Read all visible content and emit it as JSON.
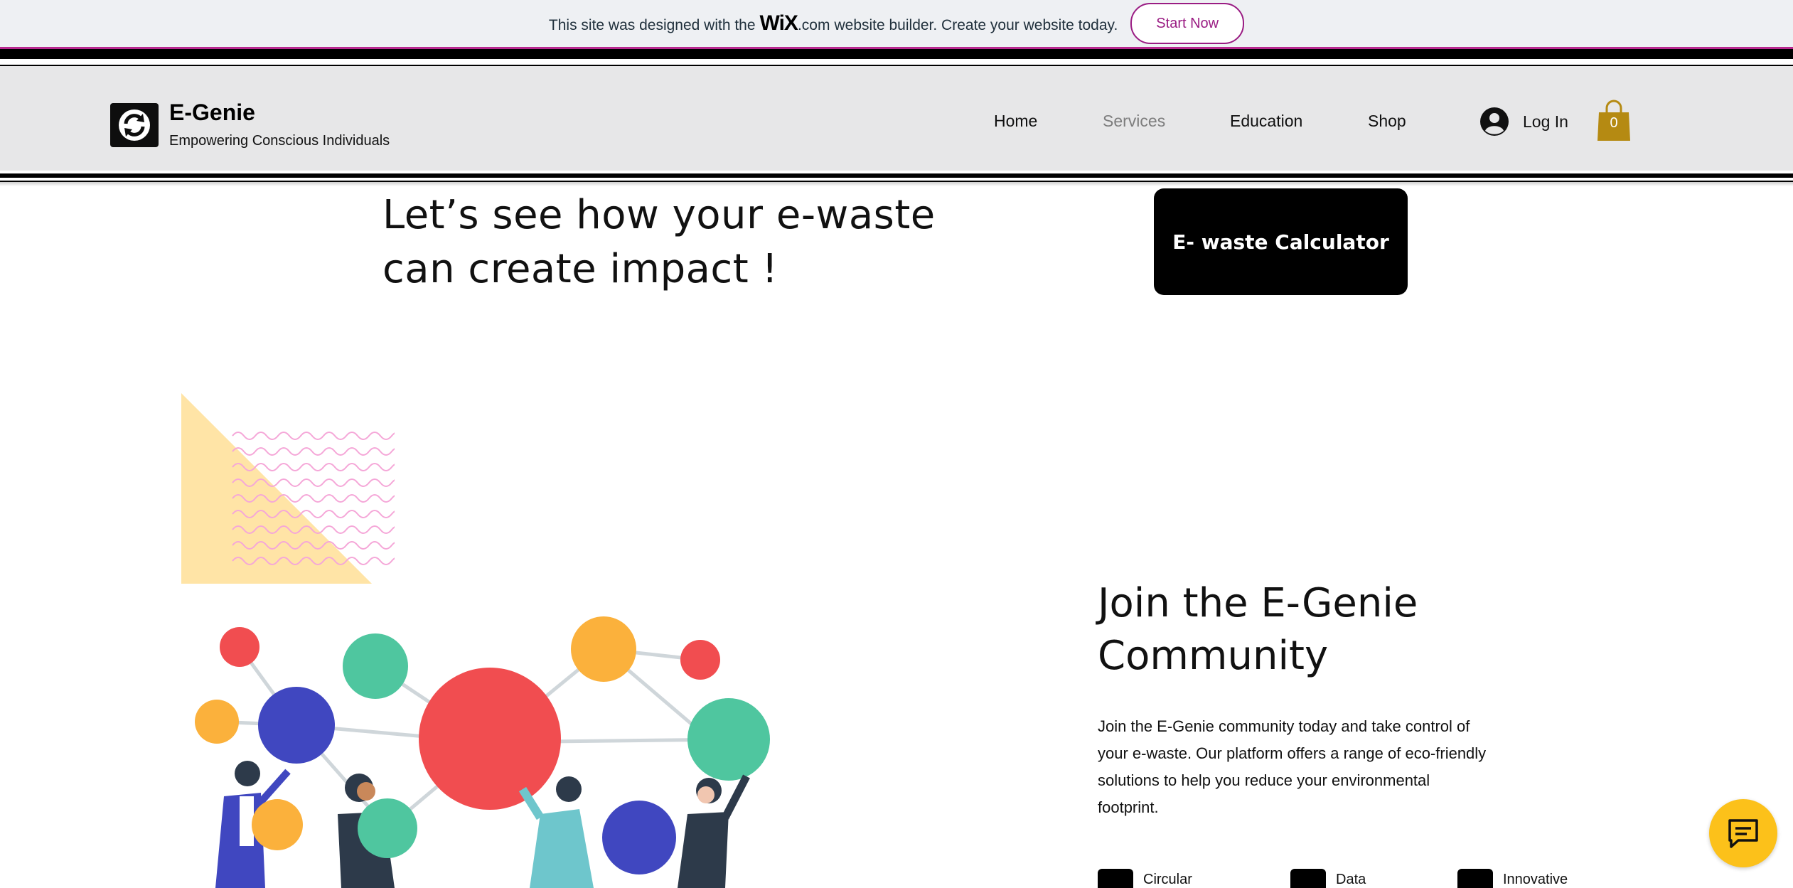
{
  "wix_banner": {
    "text_before": "This site was designed with the",
    "logo": "WiX",
    "logo_suffix": ".com",
    "text_after": "website builder. Create your website today.",
    "cta": "Start Now"
  },
  "header": {
    "brand_name": "E-Genie",
    "tagline": "Empowering Conscious Individuals",
    "logo_icon": "refresh-cycle-icon",
    "nav": [
      {
        "label": "Home"
      },
      {
        "label": "Services"
      },
      {
        "label": "Education"
      },
      {
        "label": "Shop"
      }
    ],
    "active_nav": "Services",
    "login_label": "Log In",
    "cart_count": "0"
  },
  "hero": {
    "title_line1": "Let’s see how your e-waste",
    "title_line2": "can create impact !",
    "calculator_button": "E- waste Calculator"
  },
  "community": {
    "title_line1": "Join the E-Genie",
    "title_line2": "Community",
    "description_lines": [
      "Join the E-Genie community today and take control of",
      "your e-waste. Our platform offers a range of eco-friendly",
      "solutions to help you reduce your environmental",
      "footprint."
    ],
    "features": [
      {
        "label": "Circular",
        "icon": "grid-icon"
      },
      {
        "label": "Data",
        "icon": "data-card-icon"
      },
      {
        "label": "Innovative",
        "icon": "brush-icon"
      }
    ]
  },
  "colors": {
    "accent_purple": "#9a1c83",
    "cart_gold": "#b58a12",
    "chat_yellow": "#fcc11a",
    "bubble_red": "#f14d50",
    "bubble_green": "#4fc69f",
    "bubble_orange": "#fbb13c",
    "bubble_blue": "#4047c0"
  },
  "chat_icon": "chat-bubble-icon"
}
